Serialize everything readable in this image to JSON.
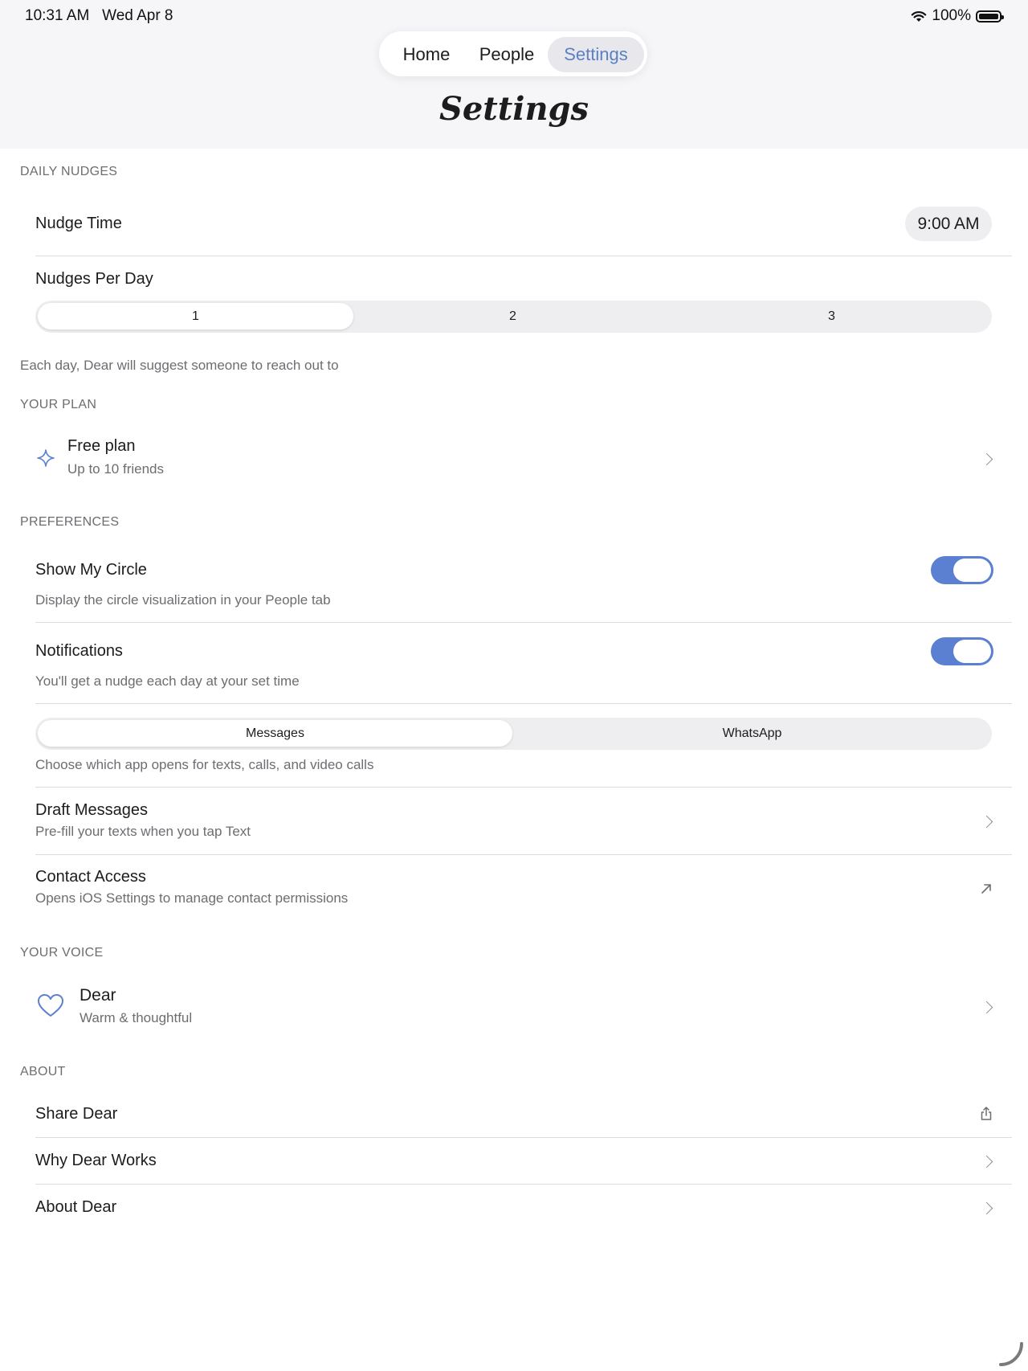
{
  "status_bar": {
    "time": "10:31 AM",
    "date": "Wed Apr 8",
    "battery": "100%",
    "wifi_icon": "wifi-icon",
    "battery_icon": "battery-icon"
  },
  "nav": {
    "tabs": [
      {
        "label": "Home"
      },
      {
        "label": "People"
      },
      {
        "label": "Settings",
        "active": true
      }
    ]
  },
  "page": {
    "title": "Settings"
  },
  "colors": {
    "accent": "#5b7fd1",
    "header_bg": "#f6f6f9",
    "secondary_text": "#6d6d72"
  },
  "daily_nudges": {
    "section_label": "DAILY NUDGES",
    "nudge_time_label": "Nudge Time",
    "nudge_time_value": "9:00 AM",
    "per_day_label": "Nudges Per Day",
    "per_day_options": [
      "1",
      "2",
      "3"
    ],
    "per_day_selected": "1",
    "footnote": "Each day, Dear will suggest someone to reach out to"
  },
  "plan": {
    "section_label": "YOUR PLAN",
    "title": "Free plan",
    "subtitle": "Up to 10 friends",
    "icon": "sparkle-icon"
  },
  "preferences": {
    "section_label": "PREFERENCES",
    "show_circle": {
      "title": "Show My Circle",
      "subtitle": "Display the circle visualization in your People tab",
      "on": true
    },
    "notifications": {
      "title": "Notifications",
      "subtitle": "You'll get a nudge each day at your set time",
      "on": true
    },
    "messaging_app": {
      "options": [
        "Messages",
        "WhatsApp"
      ],
      "selected": "Messages",
      "subtitle": "Choose which app opens for texts, calls, and video calls"
    },
    "draft_messages": {
      "title": "Draft Messages",
      "subtitle": "Pre-fill your texts when you tap Text"
    },
    "contact_access": {
      "title": "Contact Access",
      "subtitle": "Opens iOS Settings to manage contact permissions"
    }
  },
  "voice": {
    "section_label": "YOUR VOICE",
    "title": "Dear",
    "subtitle": "Warm & thoughtful",
    "icon": "heart-icon"
  },
  "about": {
    "section_label": "ABOUT",
    "items": [
      {
        "label": "Share Dear",
        "icon": "share-icon"
      },
      {
        "label": "Why Dear Works",
        "icon": "chevron-right-icon"
      },
      {
        "label": "About Dear",
        "icon": "chevron-right-icon"
      }
    ]
  }
}
